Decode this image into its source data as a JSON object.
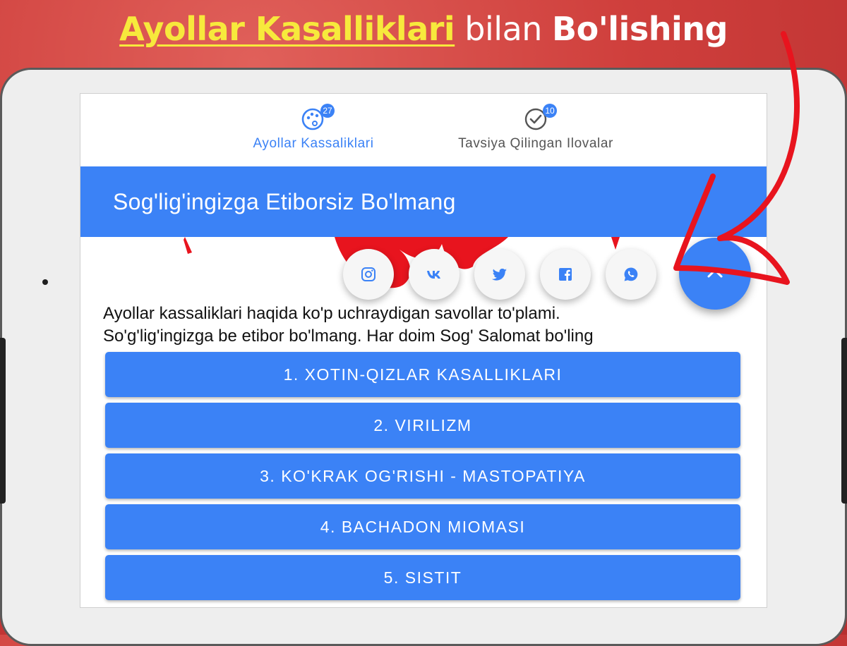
{
  "headline": {
    "part1": "Ayollar Kasalliklari",
    "part2": " bilan ",
    "part3": "Bo'lishing"
  },
  "tabs": [
    {
      "label": "Ayollar Kassaliklari",
      "badge": "27",
      "icon": "palette-icon"
    },
    {
      "label": "Tavsiya Qilingan Ilovalar",
      "badge": "10",
      "icon": "check-circle-icon"
    }
  ],
  "appbar": {
    "title": "Sog'lig'ingizga Etiborsiz Bo'lmang"
  },
  "share": {
    "buttons": [
      {
        "name": "instagram",
        "icon": "instagram-icon"
      },
      {
        "name": "vk",
        "icon": "vk-icon"
      },
      {
        "name": "twitter",
        "icon": "twitter-icon"
      },
      {
        "name": "facebook",
        "icon": "facebook-icon"
      },
      {
        "name": "whatsapp",
        "icon": "whatsapp-icon"
      }
    ],
    "fab_icon": "chevron-up-icon"
  },
  "intro": {
    "line1": "Ayollar kassaliklari haqida ko'p uchraydigan savollar to'plami.",
    "line2": "So'g'lig'ingizga be etibor bo'lmang. Har doim Sog' Salomat bo'ling"
  },
  "menu": [
    "1. XOTIN-QIZLAR KASALLIKLARI",
    "2. VIRILIZM",
    "3. KO'KRAK OG'RISHI - MASTOPATIYA",
    "4. BACHADON MIOMASI",
    "5. SISTIT"
  ],
  "colors": {
    "background": "#cf3f3c",
    "headline_accent": "#f7e93c",
    "primary": "#3b82f6",
    "arrow": "#e8141e"
  }
}
